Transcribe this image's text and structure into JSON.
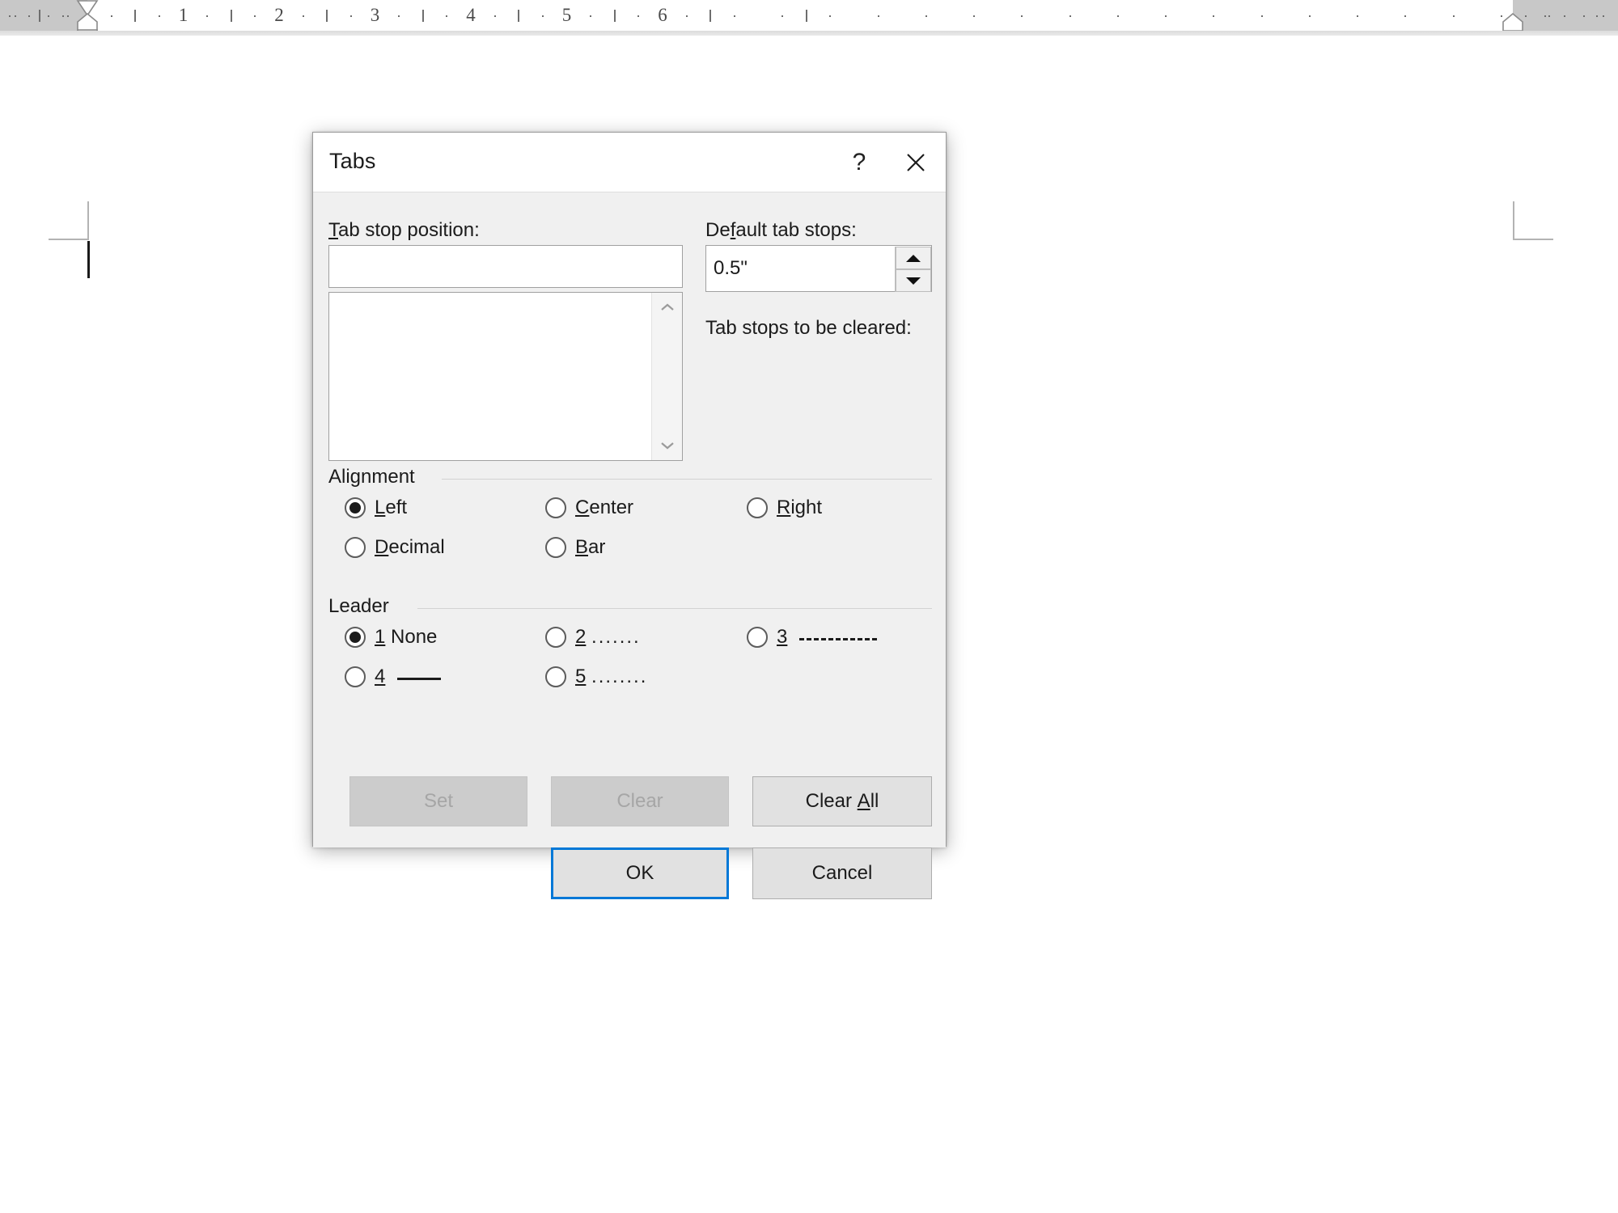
{
  "app": {
    "surface": "word-document-page"
  },
  "ruler": {
    "unit": "inch",
    "numbers": [
      "1",
      "2",
      "3",
      "4",
      "5",
      "6"
    ],
    "left_indent_marker": "first-line-indent-marker",
    "hanging_indent_marker": "hanging-indent-marker",
    "left_indent_box": "left-indent-marker",
    "right_indent_marker": "right-indent-marker"
  },
  "dialog": {
    "title": "Tabs",
    "help_icon": "?",
    "close_icon": "✕",
    "tab_stop_position": {
      "label": "Tab stop position:",
      "accel": "T",
      "value": "",
      "placeholder": ""
    },
    "tab_stop_list": {
      "items": [],
      "scroll_up_icon": "chevron-up",
      "scroll_down_icon": "chevron-down"
    },
    "default_tab_stops": {
      "label": "Default tab stops:",
      "accel": "f",
      "value": "0.5\"",
      "spinner_up": "▲",
      "spinner_down": "▼"
    },
    "cleared_label": "Tab stops to be cleared:",
    "cleared_items": [],
    "alignment": {
      "group_label": "Alignment",
      "selected": "Left",
      "options": [
        {
          "label": "Left",
          "accel": "L",
          "selected": true,
          "col": 0,
          "row": 0
        },
        {
          "label": "Center",
          "accel": "C",
          "selected": false,
          "col": 1,
          "row": 0
        },
        {
          "label": "Right",
          "accel": "R",
          "selected": false,
          "col": 2,
          "row": 0
        },
        {
          "label": "Decimal",
          "accel": "D",
          "selected": false,
          "col": 0,
          "row": 1
        },
        {
          "label": "Bar",
          "accel": "B",
          "selected": false,
          "col": 1,
          "row": 1
        }
      ]
    },
    "leader": {
      "group_label": "Leader",
      "selected": "1 None",
      "options": [
        {
          "num": "1",
          "label": "None",
          "sample": "none",
          "selected": true,
          "col": 0,
          "row": 0
        },
        {
          "num": "2",
          "label": ".......",
          "sample": "dots",
          "selected": false,
          "col": 1,
          "row": 0
        },
        {
          "num": "3",
          "label": "-------",
          "sample": "dashes",
          "selected": false,
          "col": 2,
          "row": 0
        },
        {
          "num": "4",
          "label": "___",
          "sample": "line",
          "selected": false,
          "col": 0,
          "row": 1
        },
        {
          "num": "5",
          "label": "........",
          "sample": "dots",
          "selected": false,
          "col": 1,
          "row": 1
        }
      ]
    },
    "buttons": {
      "set": {
        "label": "Set",
        "enabled": false
      },
      "clear": {
        "label": "Clear",
        "enabled": false
      },
      "clear_all": {
        "label": "Clear All",
        "enabled": true,
        "accel": "A"
      },
      "ok": {
        "label": "OK",
        "enabled": true,
        "default": true
      },
      "cancel": {
        "label": "Cancel",
        "enabled": true
      }
    }
  },
  "colors": {
    "accent": "#0078d7",
    "dialog_bg": "#f0f0f0",
    "titlebar_bg": "#ffffff",
    "button_bg": "#e1e1e1",
    "button_disabled_bg": "#cccccc",
    "text": "#1b1b1b",
    "ruler_inactive": "#c8c8c8"
  }
}
